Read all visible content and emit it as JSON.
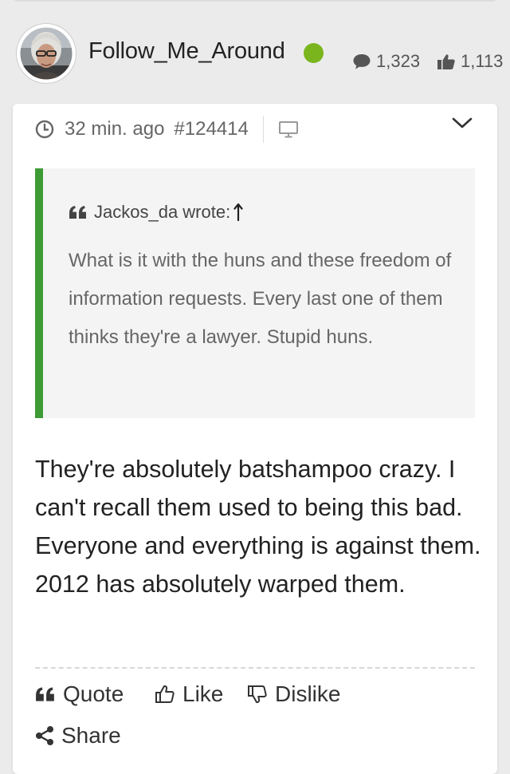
{
  "author": {
    "username": "Follow_Me_Around",
    "online_status_color": "#7ab51d",
    "post_count": "1,323",
    "like_count": "1,113",
    "avatar_icon": "user-avatar-photo"
  },
  "post": {
    "time_ago": "32 min. ago",
    "post_id": "#124414",
    "device_icon": "desktop-icon",
    "menu_icon": "chevron-down-icon",
    "quote": {
      "author_line": "Jackos_da wrote:",
      "text": "What is it with the huns and these freedom of information requests. Every last one of them thinks they're a lawyer. Stupid huns.",
      "accent_color": "#3d9b35"
    },
    "body": "They're absolutely batshampoo crazy.  I can't recall them used to being this bad.  Everyone and everything is against them.  2012 has absolutely warped them."
  },
  "actions": {
    "quote_label": "Quote",
    "like_label": "Like",
    "dislike_label": "Dislike",
    "share_label": "Share"
  }
}
